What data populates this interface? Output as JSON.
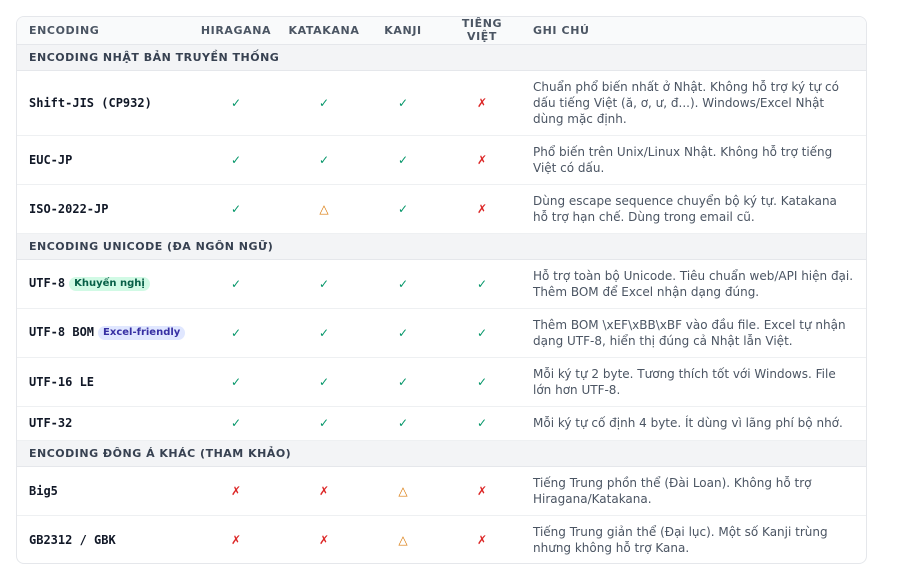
{
  "headers": {
    "encoding": "ENCODING",
    "hiragana": "HIRAGANA",
    "katakana": "KATAKANA",
    "kanji": "KANJI",
    "tieng_viet": "TIẾNG VIỆT",
    "ghi_chu": "GHI CHÚ"
  },
  "symbols": {
    "ok": "✓",
    "no": "✗",
    "warn": "△"
  },
  "colors": {
    "ok": "#059669",
    "no": "#dc2626",
    "warn": "#d97706"
  },
  "groups": [
    {
      "title": "ENCODING NHẬT BẢN TRUYỀN THỐNG",
      "rows": [
        {
          "name": "Shift-JIS (CP932)",
          "badge": "",
          "hiragana": "✓",
          "katakana": "✓",
          "kanji": "✓",
          "tieng_viet": "✗",
          "note": "Chuẩn phổ biến nhất ở Nhật. Không hỗ trợ ký tự có dấu tiếng Việt (ă, ơ, ư, đ...). Windows/Excel Nhật dùng mặc định."
        },
        {
          "name": "EUC-JP",
          "badge": "",
          "hiragana": "✓",
          "katakana": "✓",
          "kanji": "✓",
          "tieng_viet": "✗",
          "note": "Phổ biến trên Unix/Linux Nhật. Không hỗ trợ tiếng Việt có dấu."
        },
        {
          "name": "ISO-2022-JP",
          "badge": "",
          "hiragana": "✓",
          "katakana": "△",
          "kanji": "✓",
          "tieng_viet": "✗",
          "note": "Dùng escape sequence chuyển bộ ký tự. Katakana hỗ trợ hạn chế. Dùng trong email cũ."
        }
      ]
    },
    {
      "title": "ENCODING UNICODE (ĐA NGÔN NGỮ)",
      "rows": [
        {
          "name": "UTF-8",
          "badge": "Khuyến nghị",
          "hiragana": "✓",
          "katakana": "✓",
          "kanji": "✓",
          "tieng_viet": "✓",
          "note": "Hỗ trợ toàn bộ Unicode. Tiêu chuẩn web/API hiện đại. Thêm BOM để Excel nhận dạng đúng."
        },
        {
          "name": "UTF-8 BOM",
          "badge": "Excel-friendly",
          "hiragana": "✓",
          "katakana": "✓",
          "kanji": "✓",
          "tieng_viet": "✓",
          "note": "Thêm BOM \\xEF\\xBB\\xBF vào đầu file. Excel tự nhận dạng UTF-8, hiển thị đúng cả Nhật lẫn Việt."
        },
        {
          "name": "UTF-16 LE",
          "badge": "",
          "hiragana": "✓",
          "katakana": "✓",
          "kanji": "✓",
          "tieng_viet": "✓",
          "note": "Mỗi ký tự 2 byte. Tương thích tốt với Windows. File lớn hơn UTF-8."
        },
        {
          "name": "UTF-32",
          "badge": "",
          "hiragana": "✓",
          "katakana": "✓",
          "kanji": "✓",
          "tieng_viet": "✓",
          "note": "Mỗi ký tự cố định 4 byte. Ít dùng vì lãng phí bộ nhớ."
        }
      ]
    },
    {
      "title": "ENCODING ĐÔNG Á KHÁC (THAM KHẢO)",
      "rows": [
        {
          "name": "Big5",
          "badge": "",
          "hiragana": "✗",
          "katakana": "✗",
          "kanji": "△",
          "tieng_viet": "✗",
          "note": "Tiếng Trung phồn thể (Đài Loan). Không hỗ trợ Hiragana/Katakana."
        },
        {
          "name": "GB2312 / GBK",
          "badge": "",
          "hiragana": "✗",
          "katakana": "✗",
          "kanji": "△",
          "tieng_viet": "✗",
          "note": "Tiếng Trung giản thể (Đại lục). Một số Kanji trùng nhưng không hỗ trợ Kana."
        }
      ]
    }
  ]
}
